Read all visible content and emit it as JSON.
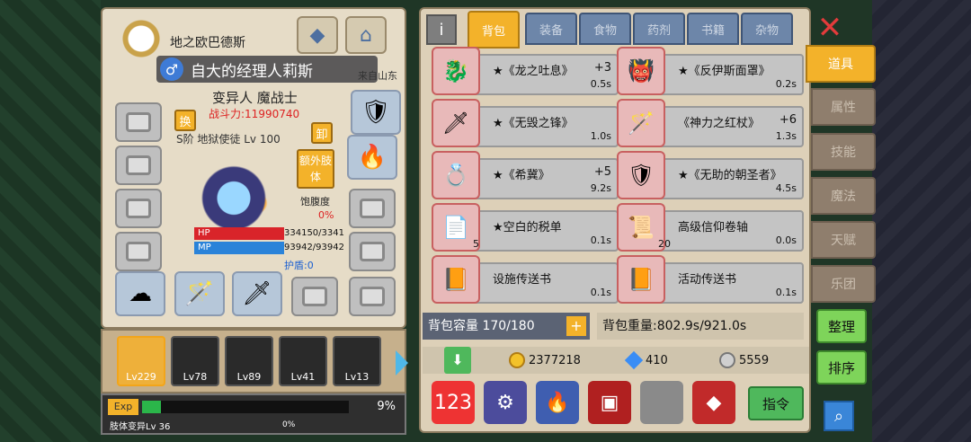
{
  "character": {
    "title": "地之欧巴德斯",
    "name": "自大的经理人莉斯",
    "origin": "来自山东",
    "class": "变异人 魔战士",
    "power": "战斗力:11990740",
    "subtitle": "S阶 地狱使徒 Lv 100",
    "swap_label": "换",
    "unequip_label": "卸",
    "extra_limb_label": "额外肢体",
    "satiety_label": "饱腹度",
    "satiety_value": "0%",
    "hp_label": "HP",
    "mp_label": "MP",
    "hp_value": "334150/3341",
    "mp_value": "93942/93942",
    "shield": "护盾:0"
  },
  "party": {
    "members": [
      {
        "level": "Lv229",
        "active": true
      },
      {
        "level": "Lv78",
        "active": false
      },
      {
        "level": "Lv89",
        "active": false
      },
      {
        "level": "Lv41",
        "active": false
      },
      {
        "level": "Lv13",
        "active": false
      }
    ]
  },
  "exp": {
    "label": "Exp",
    "percent": "9%",
    "fill_fraction": 0.09,
    "body_label": "肢体变异Lv 36",
    "body_percent": "0%"
  },
  "inventory": {
    "tabs": [
      "背包",
      "装备",
      "食物",
      "药剂",
      "书籍",
      "杂物"
    ],
    "active_tab": "背包",
    "items": [
      {
        "name": "★《龙之吐息》",
        "plus": "+3",
        "weight": "0.5s",
        "count": "",
        "icon": "dragon-head-icon",
        "emoji": "🐉"
      },
      {
        "name": "★《反伊斯面罩》",
        "plus": "",
        "weight": "0.2s",
        "count": "",
        "icon": "mask-icon",
        "emoji": "👹"
      },
      {
        "name": "★《无毁之锋》",
        "plus": "",
        "weight": "1.0s",
        "count": "",
        "icon": "sword-icon",
        "emoji": "🗡"
      },
      {
        "name": "《神力之红杖》",
        "plus": "+6",
        "weight": "1.3s",
        "count": "",
        "icon": "staff-icon",
        "emoji": "🪄"
      },
      {
        "name": "★《希冀》",
        "plus": "+5",
        "weight": "9.2s",
        "count": "",
        "icon": "ring-icon",
        "emoji": "💍"
      },
      {
        "name": "★《无助的朝圣者》",
        "plus": "",
        "weight": "4.5s",
        "count": "",
        "icon": "armor-icon",
        "emoji": "🛡"
      },
      {
        "name": "★空白的税单",
        "plus": "",
        "weight": "0.1s",
        "count": "5",
        "icon": "tax-form-icon",
        "emoji": "📄"
      },
      {
        "name": "高级信仰卷轴",
        "plus": "",
        "weight": "0.0s",
        "count": "20",
        "icon": "scroll-icon",
        "emoji": "📜"
      },
      {
        "name": "设施传送书",
        "plus": "",
        "weight": "0.1s",
        "count": "",
        "icon": "book-icon",
        "emoji": "📙"
      },
      {
        "name": "活动传送书",
        "plus": "",
        "weight": "0.1s",
        "count": "",
        "icon": "book-icon",
        "emoji": "📙"
      }
    ],
    "capacity": "背包容量 170/180",
    "weight": "背包重量:802.9s/921.0s",
    "gold": "2377218",
    "diamond": "410",
    "silver": "5559",
    "command_label": "指令"
  },
  "side": {
    "tabs": [
      "道具",
      "属性",
      "技能",
      "魔法",
      "天赋",
      "乐团"
    ],
    "active": "道具",
    "arrange_label": "整理",
    "sort_label": "排序"
  }
}
